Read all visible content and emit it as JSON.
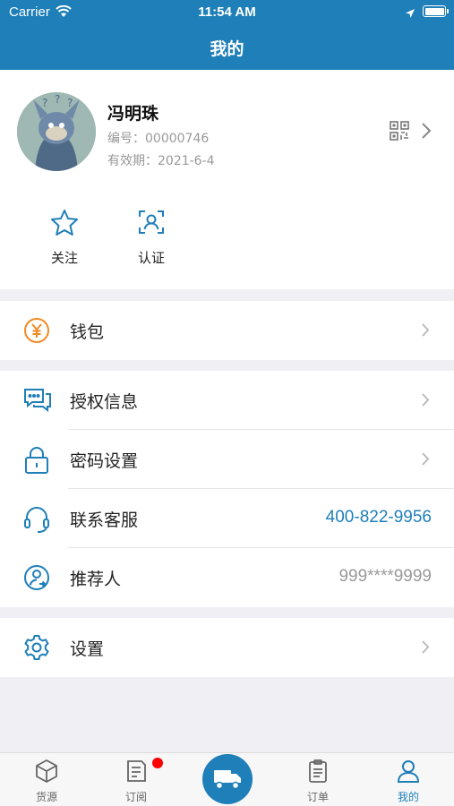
{
  "status_bar": {
    "carrier": "Carrier",
    "time": "11:54 AM"
  },
  "header": {
    "title": "我的"
  },
  "profile": {
    "name": "冯明珠",
    "number_label": "编号：",
    "number": "00000746",
    "validity_label": "有效期：",
    "validity": "2021-6-4"
  },
  "shortcuts": [
    {
      "label": "关注",
      "icon": "star-icon"
    },
    {
      "label": "认证",
      "icon": "id-scan-icon"
    }
  ],
  "menu": {
    "wallet": {
      "label": "钱包",
      "icon": "yuan-coin-icon"
    },
    "auth_info": {
      "label": "授权信息",
      "icon": "chat-bubbles-icon"
    },
    "password": {
      "label": "密码设置",
      "icon": "lock-icon"
    },
    "support": {
      "label": "联系客服",
      "value": "400-822-9956",
      "icon": "headset-icon"
    },
    "referrer": {
      "label": "推荐人",
      "value": "999****9999",
      "icon": "user-circle-icon"
    },
    "settings": {
      "label": "设置",
      "icon": "gear-icon"
    }
  },
  "tabbar": {
    "items": [
      {
        "label": "货源",
        "icon": "box-icon",
        "active": false
      },
      {
        "label": "订阅",
        "icon": "document-icon",
        "active": false,
        "badge": true
      },
      {
        "label": "",
        "icon": "truck-icon",
        "active": false
      },
      {
        "label": "订单",
        "icon": "clipboard-icon",
        "active": false
      },
      {
        "label": "我的",
        "icon": "person-icon",
        "active": true
      }
    ]
  },
  "colors": {
    "primary": "#1f7fb8",
    "wallet_accent": "#f08a24",
    "phone_link": "#1f7fb8",
    "muted_value": "#999999",
    "badge": "#ff0000"
  }
}
